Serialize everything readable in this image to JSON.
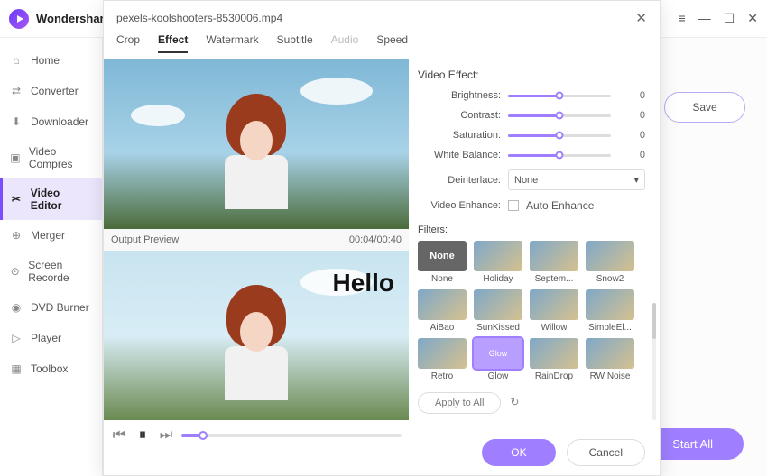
{
  "app": {
    "name": "Wondershare"
  },
  "win": {
    "menu": "≡",
    "min": "—",
    "max": "☐",
    "close": "✕"
  },
  "sidebar": [
    {
      "icon": "home",
      "label": "Home"
    },
    {
      "icon": "converter",
      "label": "Converter"
    },
    {
      "icon": "download",
      "label": "Downloader"
    },
    {
      "icon": "compress",
      "label": "Video Compres"
    },
    {
      "icon": "editor",
      "label": "Video Editor",
      "active": true
    },
    {
      "icon": "merger",
      "label": "Merger"
    },
    {
      "icon": "recorder",
      "label": "Screen Recorde"
    },
    {
      "icon": "dvd",
      "label": "DVD Burner"
    },
    {
      "icon": "player",
      "label": "Player"
    },
    {
      "icon": "toolbox",
      "label": "Toolbox"
    }
  ],
  "actions": {
    "save": "Save",
    "start_all": "Start All"
  },
  "modal": {
    "filename": "pexels-koolshooters-8530006.mp4",
    "tabs": [
      "Crop",
      "Effect",
      "Watermark",
      "Subtitle",
      "Audio",
      "Speed"
    ],
    "active_tab": "Effect",
    "disabled_tab": "Audio",
    "preview_label": "Output Preview",
    "overlay_text": "Hello",
    "timecode": "00:04/00:40",
    "effect": {
      "title": "Video Effect:",
      "sliders": [
        {
          "label": "Brightness:",
          "value": 0
        },
        {
          "label": "Contrast:",
          "value": 0
        },
        {
          "label": "Saturation:",
          "value": 0
        },
        {
          "label": "White Balance:",
          "value": 0
        }
      ],
      "deinterlace_label": "Deinterlace:",
      "deinterlace_value": "None",
      "enhance_label": "Video Enhance:",
      "auto_enhance": "Auto Enhance"
    },
    "filters": {
      "title": "Filters:",
      "items": [
        {
          "name": "None",
          "none": true
        },
        {
          "name": "Holiday"
        },
        {
          "name": "Septem..."
        },
        {
          "name": "Snow2"
        },
        {
          "name": "AiBao"
        },
        {
          "name": "SunKissed"
        },
        {
          "name": "Willow"
        },
        {
          "name": "SimpleEl..."
        },
        {
          "name": "Retro"
        },
        {
          "name": "Glow",
          "active": true
        },
        {
          "name": "RainDrop"
        },
        {
          "name": "RW Noise"
        }
      ],
      "apply_all": "Apply to All"
    },
    "buttons": {
      "ok": "OK",
      "cancel": "Cancel"
    }
  }
}
